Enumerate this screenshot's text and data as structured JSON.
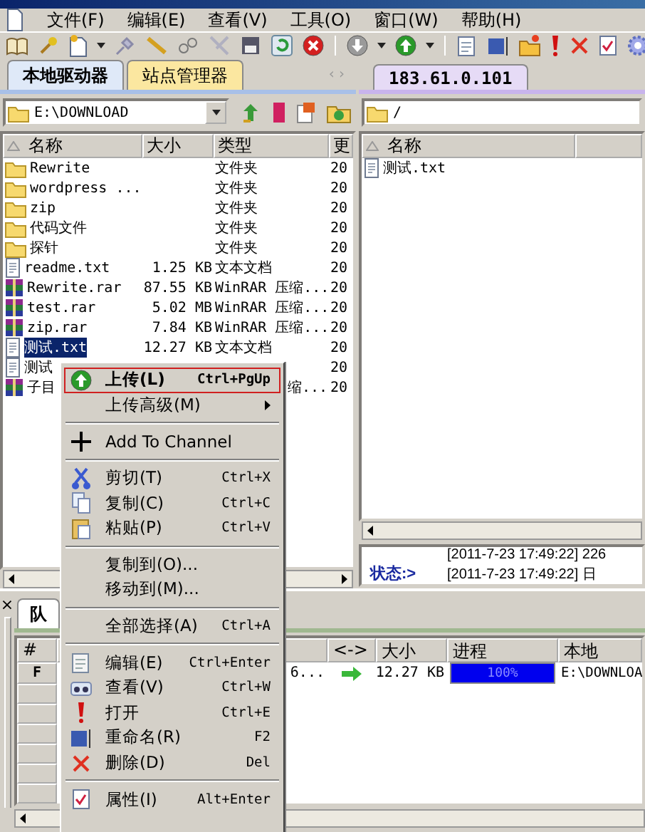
{
  "menu_bar": [
    {
      "label": "文件(F)"
    },
    {
      "label": "编辑(E)"
    },
    {
      "label": "查看(V)"
    },
    {
      "label": "工具(O)"
    },
    {
      "label": "窗口(W)"
    },
    {
      "label": "帮助(H)"
    }
  ],
  "local_pane": {
    "tabs": [
      {
        "label": "本地驱动器",
        "selected": true
      },
      {
        "label": "站点管理器",
        "selected": false
      }
    ],
    "tab_scroll": "‹ ›",
    "path": "E:\\DOWNLOAD",
    "columns": [
      "名称",
      "大小",
      "类型",
      "更"
    ],
    "files": [
      {
        "name": "Rewrite",
        "type": "文件夹",
        "date": "20",
        "kind": "folder",
        "selected": false
      },
      {
        "name": "wordpress ...",
        "type": "文件夹",
        "date": "20",
        "kind": "folder",
        "selected": false
      },
      {
        "name": "zip",
        "type": "文件夹",
        "date": "20",
        "kind": "folder",
        "selected": false
      },
      {
        "name": "代码文件",
        "type": "文件夹",
        "date": "20",
        "kind": "folder",
        "selected": false
      },
      {
        "name": "探针",
        "type": "文件夹",
        "date": "20",
        "kind": "folder",
        "selected": false
      },
      {
        "name": "readme.txt",
        "size": "1.25 KB",
        "type": "文本文档",
        "date": "20",
        "kind": "text",
        "selected": false
      },
      {
        "name": "Rewrite.rar",
        "size": "87.55 KB",
        "type": "WinRAR 压缩...",
        "date": "20",
        "kind": "archive",
        "selected": false
      },
      {
        "name": "test.rar",
        "size": "5.02 MB",
        "type": "WinRAR 压缩...",
        "date": "20",
        "kind": "archive",
        "selected": false
      },
      {
        "name": "zip.rar",
        "size": "7.84 KB",
        "type": "WinRAR 压缩...",
        "date": "20",
        "kind": "archive",
        "selected": false
      },
      {
        "name": "测试.txt",
        "size": "12.27 KB",
        "type": "文本文档",
        "date": "20",
        "kind": "text",
        "selected": true
      },
      {
        "name": "测试",
        "date": "20",
        "kind": "text",
        "selected": false
      },
      {
        "name": "子目",
        "type": "缩...",
        "date": "20",
        "kind": "archive",
        "selected": false
      }
    ]
  },
  "remote_pane": {
    "tabs": [
      {
        "label": "183.61.0.101",
        "selected": true
      }
    ],
    "path": "/",
    "columns": [
      "名称"
    ],
    "files": [
      {
        "name": "测试.txt",
        "kind": "text",
        "selected": false
      }
    ],
    "status": {
      "label": "状态:>",
      "lines": [
        "[2011-7-23 17:49:22] 226",
        "[2011-7-23 17:49:22] 日"
      ]
    }
  },
  "queue": {
    "close": "×",
    "tabs": [
      {
        "label": "队",
        "selected": true
      }
    ],
    "columns": [
      {
        "label": "#"
      },
      {
        "label": "<->"
      },
      {
        "label": "大小"
      },
      {
        "label": "进程"
      },
      {
        "label": "本地"
      }
    ],
    "rows": [
      {
        "number": "F",
        "name": "6...",
        "size": "12.27 KB",
        "progress": {
          "level": 1,
          "text": "100%"
        },
        "local": "E:\\DOWNLOA"
      }
    ]
  },
  "context_menu": {
    "groups": [
      [
        {
          "label": "上传(L)",
          "shortcut": "Ctrl+PgUp",
          "kind": "command",
          "selected": true
        },
        {
          "label": "上传高级(M)",
          "kind": "submenu",
          "selected": false
        }
      ],
      [
        {
          "label": "Add To Channel",
          "kind": "command",
          "selected": false
        }
      ],
      [
        {
          "label": "剪切(T)",
          "shortcut": "Ctrl+X",
          "kind": "command",
          "selected": false
        },
        {
          "label": "复制(C)",
          "shortcut": "Ctrl+C",
          "kind": "command",
          "selected": false
        },
        {
          "label": "粘贴(P)",
          "shortcut": "Ctrl+V",
          "kind": "command",
          "selected": false
        }
      ],
      [
        {
          "label": "复制到(O)...",
          "kind": "command",
          "selected": false
        },
        {
          "label": "移动到(M)...",
          "kind": "command",
          "selected": false
        }
      ],
      [
        {
          "label": "全部选择(A)",
          "shortcut": "Ctrl+A",
          "kind": "command",
          "selected": false
        }
      ],
      [
        {
          "label": "编辑(E)",
          "shortcut": "Ctrl+Enter",
          "kind": "command",
          "selected": false
        },
        {
          "label": "查看(V)",
          "shortcut": "Ctrl+W",
          "kind": "command",
          "selected": false
        },
        {
          "label": "打开",
          "shortcut": "Ctrl+E",
          "kind": "command",
          "selected": false
        },
        {
          "label": "重命名(R)",
          "shortcut": "F2",
          "kind": "command",
          "selected": false
        },
        {
          "label": "删除(D)",
          "shortcut": "Del",
          "kind": "command",
          "selected": false
        }
      ],
      [
        {
          "label": "属性(I)",
          "shortcut": "Alt+Enter",
          "kind": "command",
          "selected": false
        }
      ]
    ]
  }
}
